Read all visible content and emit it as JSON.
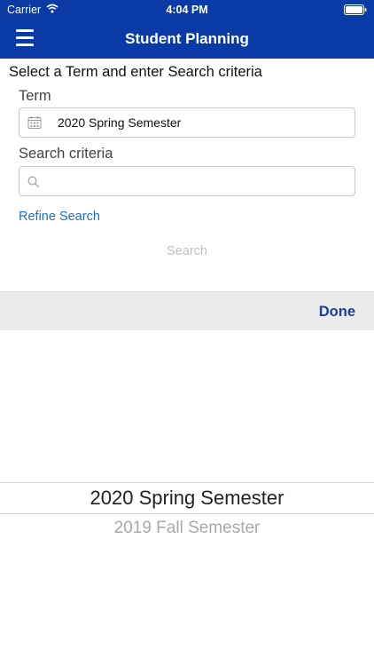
{
  "status_bar": {
    "carrier": "Carrier",
    "time": "4:04 PM"
  },
  "nav": {
    "title": "Student Planning"
  },
  "form": {
    "instruction": "Select a Term and enter Search criteria",
    "term_label": "Term",
    "term_value": "2020 Spring Semester",
    "criteria_label": "Search criteria",
    "criteria_value": "",
    "criteria_placeholder": "",
    "refine_label": "Refine Search",
    "search_label": "Search"
  },
  "picker": {
    "done_label": "Done",
    "options": [
      "2020 Spring Semester",
      "2019 Fall Semester"
    ],
    "selected": "2020 Spring Semester"
  },
  "colors": {
    "brand": "#0a3aa6",
    "link": "#1f6fc9",
    "done": "#1a3f9a",
    "disabled": "#c2c2c2"
  },
  "icons": [
    "wifi-icon",
    "battery-icon",
    "menu-icon",
    "calendar-icon",
    "search-icon"
  ]
}
